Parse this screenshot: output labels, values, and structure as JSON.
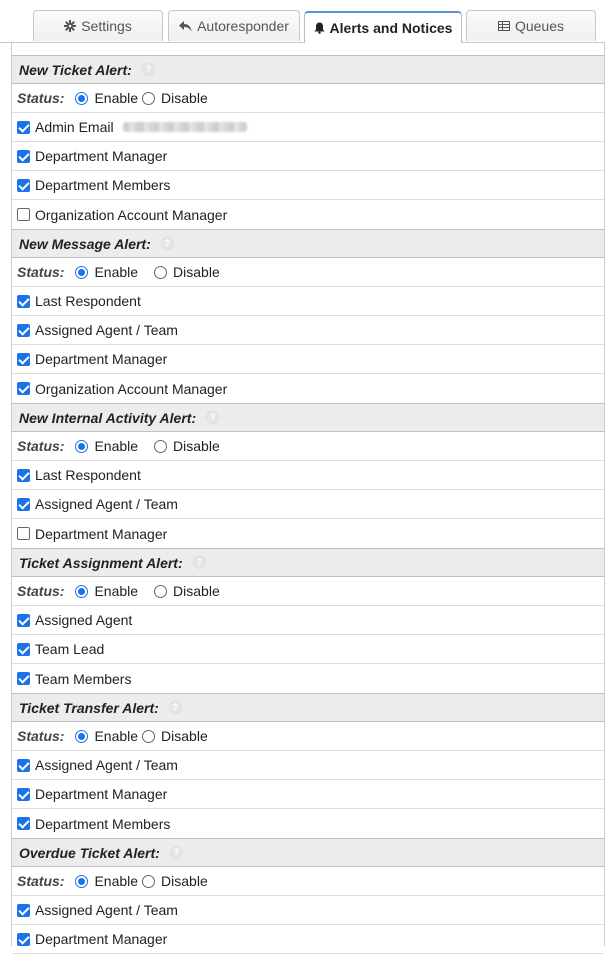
{
  "tabs": [
    {
      "label": "Settings",
      "icon": "gear-icon"
    },
    {
      "label": "Autoresponder",
      "icon": "reply-icon"
    },
    {
      "label": "Alerts and Notices",
      "icon": "bell-icon"
    },
    {
      "label": "Queues",
      "icon": "table-icon"
    }
  ],
  "active_tab": "Alerts and Notices",
  "status_label": "Status:",
  "enable_label": "Enable",
  "disable_label": "Disable",
  "sections": [
    {
      "title": "New Ticket Alert",
      "status": "enable",
      "items": [
        {
          "label": "Admin Email",
          "checked": true
        },
        {
          "label": "Department Manager",
          "checked": true
        },
        {
          "label": "Department Members",
          "checked": true
        },
        {
          "label": "Organization Account Manager",
          "checked": false
        }
      ]
    },
    {
      "title": "New Message Alert",
      "status": "enable",
      "items": [
        {
          "label": "Last Respondent",
          "checked": true
        },
        {
          "label": "Assigned Agent / Team",
          "checked": true
        },
        {
          "label": "Department Manager",
          "checked": true
        },
        {
          "label": "Organization Account Manager",
          "checked": true
        }
      ]
    },
    {
      "title": "New Internal Activity Alert",
      "status": "enable",
      "items": [
        {
          "label": "Last Respondent",
          "checked": true
        },
        {
          "label": "Assigned Agent / Team",
          "checked": true
        },
        {
          "label": "Department Manager",
          "checked": false
        }
      ]
    },
    {
      "title": "Ticket Assignment Alert",
      "status": "enable",
      "items": [
        {
          "label": "Assigned Agent",
          "checked": true
        },
        {
          "label": "Team Lead",
          "checked": true
        },
        {
          "label": "Team Members",
          "checked": true
        }
      ]
    },
    {
      "title": "Ticket Transfer Alert",
      "status": "enable",
      "items": [
        {
          "label": "Assigned Agent / Team",
          "checked": true
        },
        {
          "label": "Department Manager",
          "checked": true
        },
        {
          "label": "Department Members",
          "checked": true
        }
      ]
    },
    {
      "title": "Overdue Ticket Alert",
      "status": "enable",
      "items": [
        {
          "label": "Assigned Agent / Team",
          "checked": true
        },
        {
          "label": "Department Manager",
          "checked": true
        }
      ]
    }
  ],
  "colors": {
    "accent": "#1a73e8",
    "tab_highlight": "#5b93d1",
    "header_bg": "#ececec"
  }
}
